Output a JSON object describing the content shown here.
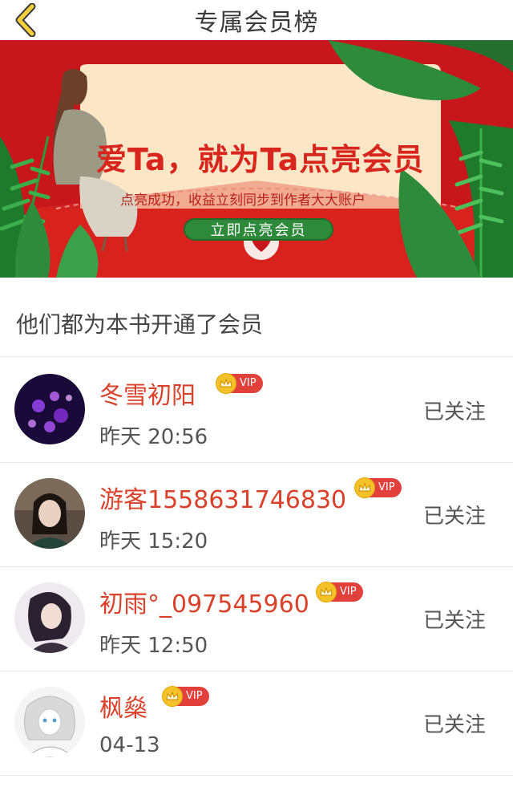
{
  "header": {
    "title": "专属会员榜"
  },
  "banner": {
    "headline": "爱Ta，就为Ta点亮会员",
    "subtitle": "点亮成功，收益立刻同步到作者大大账户",
    "button_label": "立即点亮会员"
  },
  "section": {
    "title": "他们都为本书开通了会员"
  },
  "members": [
    {
      "name": "冬雪初阳",
      "vip_label": "VIP",
      "time": "昨天 20:56",
      "follow_status": "已关注"
    },
    {
      "name": "游客1558631746830",
      "vip_label": "VIP",
      "time": "昨天 15:20",
      "follow_status": "已关注"
    },
    {
      "name": "初雨°_097545960",
      "vip_label": "VIP",
      "time": "昨天 12:50",
      "follow_status": "已关注"
    },
    {
      "name": "枫燊",
      "vip_label": "VIP",
      "time": "04-13",
      "follow_status": "已关注"
    }
  ],
  "colors": {
    "accent_red": "#d9412a",
    "vip_gold": "#f4c228",
    "button_green": "#2d8a3a"
  },
  "icons": {
    "back": "chevron-left-icon",
    "crown": "crown-icon"
  }
}
